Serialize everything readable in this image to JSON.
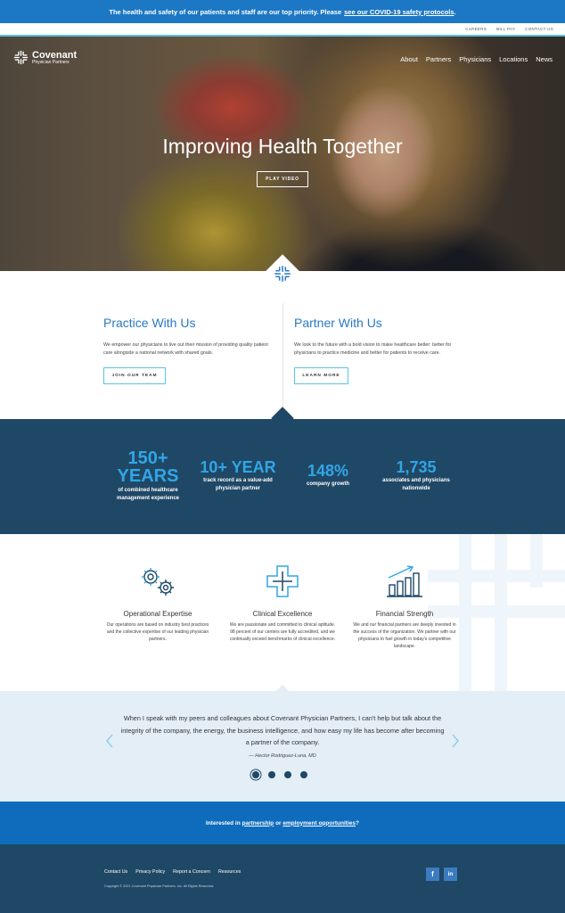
{
  "alert": {
    "text": "The health and safety of our patients and staff are our top priority. Please",
    "link": "see our COVID-19 safety protocols",
    "end": "."
  },
  "utility_nav": [
    "CAREERS",
    "BILL PAY",
    "CONTACT US"
  ],
  "logo": {
    "name": "Covenant",
    "sub": "Physician Partners"
  },
  "main_nav": [
    "About",
    "Partners",
    "Physicians",
    "Locations",
    "News"
  ],
  "hero": {
    "title": "Improving Health Together",
    "button": "PLAY VIDEO"
  },
  "practice": {
    "title": "Practice With Us",
    "body": "We empower our physicians to live out their mission of providing quality patient care alongside a national network with shared goals.",
    "button": "JOIN OUR TEAM"
  },
  "partner": {
    "title": "Partner With Us",
    "body": "We look to the future with a bold vision to make healthcare better: better for physicians to practice medicine and better for patients to receive care.",
    "button": "LEARN MORE"
  },
  "stats": [
    {
      "num_line1": "150+",
      "num_line2": "YEARS",
      "label_line1": "of combined healthcare",
      "label_line2": "management experience"
    },
    {
      "num_line1": "10+ YEAR",
      "label_line1": "track record as a value-add",
      "label_line2": "physician partner"
    },
    {
      "num_line1": "148%",
      "label_line1": "company growth"
    },
    {
      "num_line1": "1,735",
      "label_line1": "associates and physicians",
      "label_line2": "nationwide"
    }
  ],
  "features": [
    {
      "icon": "gears-icon",
      "title": "Operational Expertise",
      "body": "Our operations are based on industry best practices and the collective expertise of our leading physician partners."
    },
    {
      "icon": "medical-cross-icon",
      "title": "Clinical Excellence",
      "body": "We are passionate and committed to clinical aptitude. 98 percent of our centers are fully accredited, and we continually exceed benchmarks of clinical excellence."
    },
    {
      "icon": "growth-chart-icon",
      "title": "Financial Strength",
      "body": "We and our financial partners are deeply invested in the success of the organization. We partner with our physicians to fuel growth in today's competitive landscape."
    }
  ],
  "testimonial": {
    "quote": "When I speak with my peers and colleagues about Covenant Physician Partners, I can't help but talk about the integrity of the company, the energy, the business intelligence, and how easy my life has become after becoming a partner of the company.",
    "author": "— Hector Rodriguez-Luna, MD",
    "slides": 4,
    "active": 0
  },
  "cta": {
    "prefix": "Interested in",
    "link1": "partnership",
    "mid": "or",
    "link2": "employment opportunities",
    "suffix": "?"
  },
  "footer": {
    "links": [
      "Contact Us",
      "Privacy Policy",
      "Report a Concern",
      "Resources"
    ],
    "copyright": "Copyright © 2021 Covenant Physician Partners, Inc. All Rights Reserved.",
    "social": [
      "f",
      "in"
    ]
  },
  "colors": {
    "brand_blue": "#1c78c5",
    "navy": "#1f4866",
    "accent": "#31a6e6",
    "light_blue": "#e3eef7"
  }
}
